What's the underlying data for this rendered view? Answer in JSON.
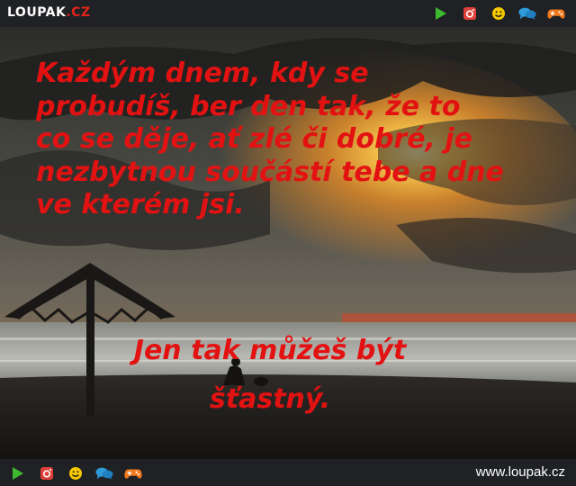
{
  "header": {
    "logo_main": "LOUPAK",
    "logo_tld": ".CZ",
    "icons": [
      "play-icon",
      "instagram-icon",
      "smiley-icon",
      "chat-icon",
      "gamepad-icon"
    ]
  },
  "quote": {
    "text": "Každým dnem, kdy se probudíš, ber den tak, že to co se děje, ať zlé či dobré, je nezbytnou součástí tebe a dne ve kterém jsi.",
    "line2": "Jen tak můžeš být",
    "line3": "šťastný."
  },
  "footer": {
    "site": "www.loupak.cz",
    "icons": [
      "play-icon",
      "instagram-icon",
      "smiley-icon",
      "chat-icon",
      "gamepad-icon"
    ]
  },
  "colors": {
    "quote": "#e31212",
    "bar": "#1f2124",
    "play": "#3db82f",
    "instagram": "#e0403a",
    "smiley": "#f5c800",
    "chat": "#2f9ad8",
    "gamepad": "#f07a1e"
  }
}
